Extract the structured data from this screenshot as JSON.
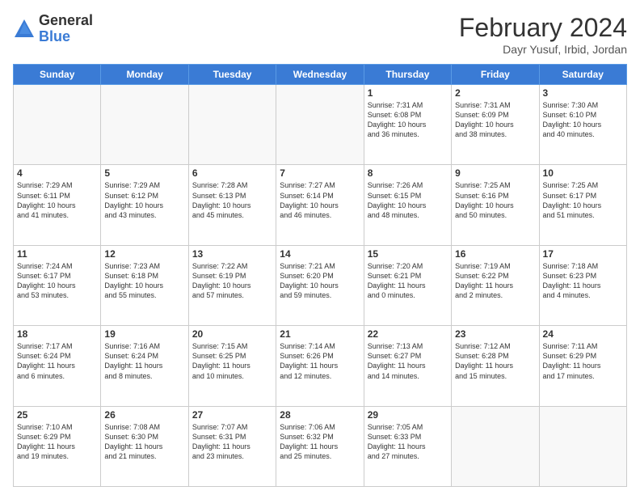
{
  "logo": {
    "general": "General",
    "blue": "Blue"
  },
  "title": "February 2024",
  "subtitle": "Dayr Yusuf, Irbid, Jordan",
  "days_of_week": [
    "Sunday",
    "Monday",
    "Tuesday",
    "Wednesday",
    "Thursday",
    "Friday",
    "Saturday"
  ],
  "weeks": [
    [
      {
        "day": "",
        "info": ""
      },
      {
        "day": "",
        "info": ""
      },
      {
        "day": "",
        "info": ""
      },
      {
        "day": "",
        "info": ""
      },
      {
        "day": "1",
        "info": "Sunrise: 7:31 AM\nSunset: 6:08 PM\nDaylight: 10 hours\nand 36 minutes."
      },
      {
        "day": "2",
        "info": "Sunrise: 7:31 AM\nSunset: 6:09 PM\nDaylight: 10 hours\nand 38 minutes."
      },
      {
        "day": "3",
        "info": "Sunrise: 7:30 AM\nSunset: 6:10 PM\nDaylight: 10 hours\nand 40 minutes."
      }
    ],
    [
      {
        "day": "4",
        "info": "Sunrise: 7:29 AM\nSunset: 6:11 PM\nDaylight: 10 hours\nand 41 minutes."
      },
      {
        "day": "5",
        "info": "Sunrise: 7:29 AM\nSunset: 6:12 PM\nDaylight: 10 hours\nand 43 minutes."
      },
      {
        "day": "6",
        "info": "Sunrise: 7:28 AM\nSunset: 6:13 PM\nDaylight: 10 hours\nand 45 minutes."
      },
      {
        "day": "7",
        "info": "Sunrise: 7:27 AM\nSunset: 6:14 PM\nDaylight: 10 hours\nand 46 minutes."
      },
      {
        "day": "8",
        "info": "Sunrise: 7:26 AM\nSunset: 6:15 PM\nDaylight: 10 hours\nand 48 minutes."
      },
      {
        "day": "9",
        "info": "Sunrise: 7:25 AM\nSunset: 6:16 PM\nDaylight: 10 hours\nand 50 minutes."
      },
      {
        "day": "10",
        "info": "Sunrise: 7:25 AM\nSunset: 6:17 PM\nDaylight: 10 hours\nand 51 minutes."
      }
    ],
    [
      {
        "day": "11",
        "info": "Sunrise: 7:24 AM\nSunset: 6:17 PM\nDaylight: 10 hours\nand 53 minutes."
      },
      {
        "day": "12",
        "info": "Sunrise: 7:23 AM\nSunset: 6:18 PM\nDaylight: 10 hours\nand 55 minutes."
      },
      {
        "day": "13",
        "info": "Sunrise: 7:22 AM\nSunset: 6:19 PM\nDaylight: 10 hours\nand 57 minutes."
      },
      {
        "day": "14",
        "info": "Sunrise: 7:21 AM\nSunset: 6:20 PM\nDaylight: 10 hours\nand 59 minutes."
      },
      {
        "day": "15",
        "info": "Sunrise: 7:20 AM\nSunset: 6:21 PM\nDaylight: 11 hours\nand 0 minutes."
      },
      {
        "day": "16",
        "info": "Sunrise: 7:19 AM\nSunset: 6:22 PM\nDaylight: 11 hours\nand 2 minutes."
      },
      {
        "day": "17",
        "info": "Sunrise: 7:18 AM\nSunset: 6:23 PM\nDaylight: 11 hours\nand 4 minutes."
      }
    ],
    [
      {
        "day": "18",
        "info": "Sunrise: 7:17 AM\nSunset: 6:24 PM\nDaylight: 11 hours\nand 6 minutes."
      },
      {
        "day": "19",
        "info": "Sunrise: 7:16 AM\nSunset: 6:24 PM\nDaylight: 11 hours\nand 8 minutes."
      },
      {
        "day": "20",
        "info": "Sunrise: 7:15 AM\nSunset: 6:25 PM\nDaylight: 11 hours\nand 10 minutes."
      },
      {
        "day": "21",
        "info": "Sunrise: 7:14 AM\nSunset: 6:26 PM\nDaylight: 11 hours\nand 12 minutes."
      },
      {
        "day": "22",
        "info": "Sunrise: 7:13 AM\nSunset: 6:27 PM\nDaylight: 11 hours\nand 14 minutes."
      },
      {
        "day": "23",
        "info": "Sunrise: 7:12 AM\nSunset: 6:28 PM\nDaylight: 11 hours\nand 15 minutes."
      },
      {
        "day": "24",
        "info": "Sunrise: 7:11 AM\nSunset: 6:29 PM\nDaylight: 11 hours\nand 17 minutes."
      }
    ],
    [
      {
        "day": "25",
        "info": "Sunrise: 7:10 AM\nSunset: 6:29 PM\nDaylight: 11 hours\nand 19 minutes."
      },
      {
        "day": "26",
        "info": "Sunrise: 7:08 AM\nSunset: 6:30 PM\nDaylight: 11 hours\nand 21 minutes."
      },
      {
        "day": "27",
        "info": "Sunrise: 7:07 AM\nSunset: 6:31 PM\nDaylight: 11 hours\nand 23 minutes."
      },
      {
        "day": "28",
        "info": "Sunrise: 7:06 AM\nSunset: 6:32 PM\nDaylight: 11 hours\nand 25 minutes."
      },
      {
        "day": "29",
        "info": "Sunrise: 7:05 AM\nSunset: 6:33 PM\nDaylight: 11 hours\nand 27 minutes."
      },
      {
        "day": "",
        "info": ""
      },
      {
        "day": "",
        "info": ""
      }
    ]
  ]
}
